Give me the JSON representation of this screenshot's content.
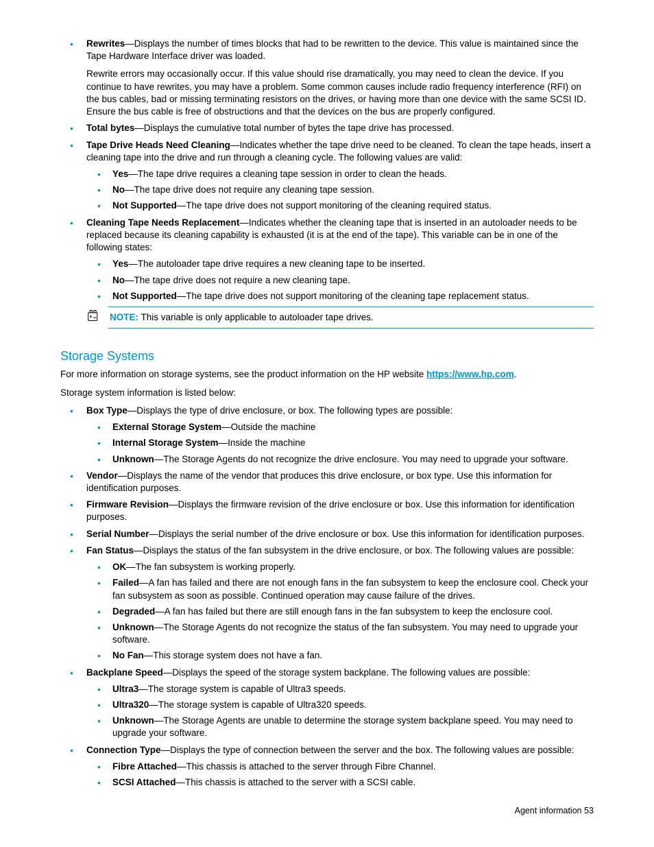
{
  "sec1": {
    "items": [
      {
        "term": "Rewrites",
        "desc": "—Displays the number of times blocks that had to be rewritten to the device. This value is maintained since the Tape Hardware Interface driver was loaded.",
        "follow": "Rewrite errors may occasionally occur. If this value should rise dramatically, you may need to clean the device. If you continue to have rewrites, you may have a problem. Some common causes include radio frequency interference (RFI) on the bus cables, bad or missing terminating resistors on the drives, or having more than one device with the same SCSI ID. Ensure the bus cable is free of obstructions and that the devices on the bus are properly configured."
      },
      {
        "term": "Total bytes",
        "desc": "—Displays the cumulative total number of bytes the tape drive has processed."
      },
      {
        "term": "Tape Drive Heads Need Cleaning",
        "desc": "—Indicates whether the tape drive need to be cleaned. To clean the tape heads, insert a cleaning tape into the drive and run through a cleaning cycle. The following values are valid:",
        "sub": [
          {
            "t": "Yes",
            "d": "—The tape drive requires a cleaning tape session in order to clean the heads."
          },
          {
            "t": "No",
            "d": "—The tape drive does not require any cleaning tape session."
          },
          {
            "t": "Not Supported",
            "d": "—The tape drive does not support monitoring of the cleaning required status."
          }
        ]
      },
      {
        "term": "Cleaning Tape Needs Replacement",
        "desc": "—Indicates whether the cleaning tape that is inserted in an autoloader needs to be replaced because its cleaning capability is exhausted (it is at the end of the tape). This variable can be in one of the following states:",
        "sub": [
          {
            "t": "Yes",
            "d": "—The autoloader tape drive requires a new cleaning tape to be inserted."
          },
          {
            "t": "No",
            "d": "—The tape drive does not require a new cleaning tape."
          },
          {
            "t": "Not Supported",
            "d": "—The tape drive does not support monitoring of the cleaning tape replacement status."
          }
        ]
      }
    ]
  },
  "note": {
    "label": "NOTE:",
    "text": "  This variable is only applicable to autoloader tape drives."
  },
  "sec2": {
    "heading": "Storage Systems",
    "intro1a": "For more information on storage systems, see the product information on the HP website ",
    "link": "https://www.hp.com",
    "intro1b": ".",
    "intro2": "Storage system information is listed below:",
    "items": [
      {
        "term": "Box Type",
        "desc": "—Displays the type of drive enclosure, or box. The following types are possible:",
        "sub": [
          {
            "t": "External Storage System",
            "d": "—Outside the machine"
          },
          {
            "t": "Internal Storage System",
            "d": "—Inside the machine"
          },
          {
            "t": "Unknown",
            "d": "—The Storage Agents do not recognize the drive enclosure. You may need to upgrade your software."
          }
        ]
      },
      {
        "term": "Vendor",
        "desc": "—Displays the name of the vendor that produces this drive enclosure, or box type. Use this information for identification purposes."
      },
      {
        "term": "Firmware Revision",
        "desc": "—Displays the firmware revision of the drive enclosure or box. Use this information for identification purposes."
      },
      {
        "term": "Serial Number",
        "desc": "—Displays the serial number of the drive enclosure or box. Use this information for identification purposes."
      },
      {
        "term": "Fan Status",
        "desc": "—Displays the status of the fan subsystem in the drive enclosure, or box. The following values are possible:",
        "sub": [
          {
            "t": "OK",
            "d": "—The fan subsystem is working properly."
          },
          {
            "t": "Failed",
            "d": "—A fan has failed and there are not enough fans in the fan subsystem to keep the enclosure cool. Check your fan subsystem as soon as possible. Continued operation may cause failure of the drives."
          },
          {
            "t": "Degraded",
            "d": "—A fan has failed but there are still enough fans in the fan subsystem to keep the enclosure cool."
          },
          {
            "t": "Unknown",
            "d": "—The Storage Agents do not recognize the status of the fan subsystem. You may need to upgrade your software."
          },
          {
            "t": "No Fan",
            "d": "—This storage system does not have a fan."
          }
        ]
      },
      {
        "term": "Backplane Speed",
        "desc": "—Displays the speed of the storage system backplane. The following values are possible:",
        "sub": [
          {
            "t": "Ultra3",
            "d": "—The storage system is capable of Ultra3 speeds."
          },
          {
            "t": "Ultra320",
            "d": "—The storage system is capable of Ultra320 speeds."
          },
          {
            "t": "Unknown",
            "d": "—The Storage Agents are unable to determine the storage system backplane speed. You may need to upgrade your software."
          }
        ]
      },
      {
        "term": "Connection Type",
        "desc": "—Displays the type of connection between the server and the box. The following values are possible:",
        "sub": [
          {
            "t": "Fibre Attached",
            "d": "—This chassis is attached to the server through Fibre Channel."
          },
          {
            "t": "SCSI Attached",
            "d": "—This chassis is attached to the server with a SCSI cable."
          }
        ]
      }
    ]
  },
  "footer": {
    "text": "Agent information   53"
  }
}
